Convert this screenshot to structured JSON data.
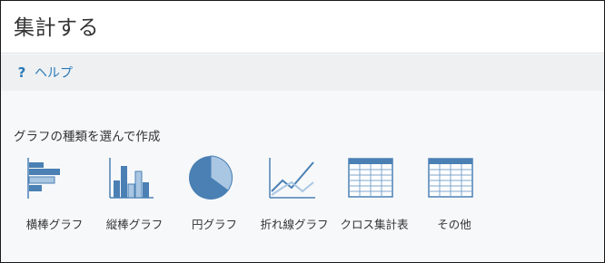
{
  "window": {
    "title": "集計する"
  },
  "help": {
    "label": "ヘルプ",
    "icon": "question-icon"
  },
  "section": {
    "title": "グラフの種類を選んで作成"
  },
  "chart_types": [
    {
      "label": "横棒グラフ",
      "icon": "horizontal-bar-chart-icon"
    },
    {
      "label": "縦棒グラフ",
      "icon": "vertical-bar-chart-icon"
    },
    {
      "label": "円グラフ",
      "icon": "pie-chart-icon"
    },
    {
      "label": "折れ線グラフ",
      "icon": "line-chart-icon"
    },
    {
      "label": "クロス集計表",
      "icon": "cross-table-icon"
    },
    {
      "label": "その他",
      "icon": "other-table-icon"
    }
  ],
  "colors": {
    "accent": "#2a7ab8",
    "icon_dark": "#4a80b4",
    "icon_light": "#a9c6e2"
  }
}
